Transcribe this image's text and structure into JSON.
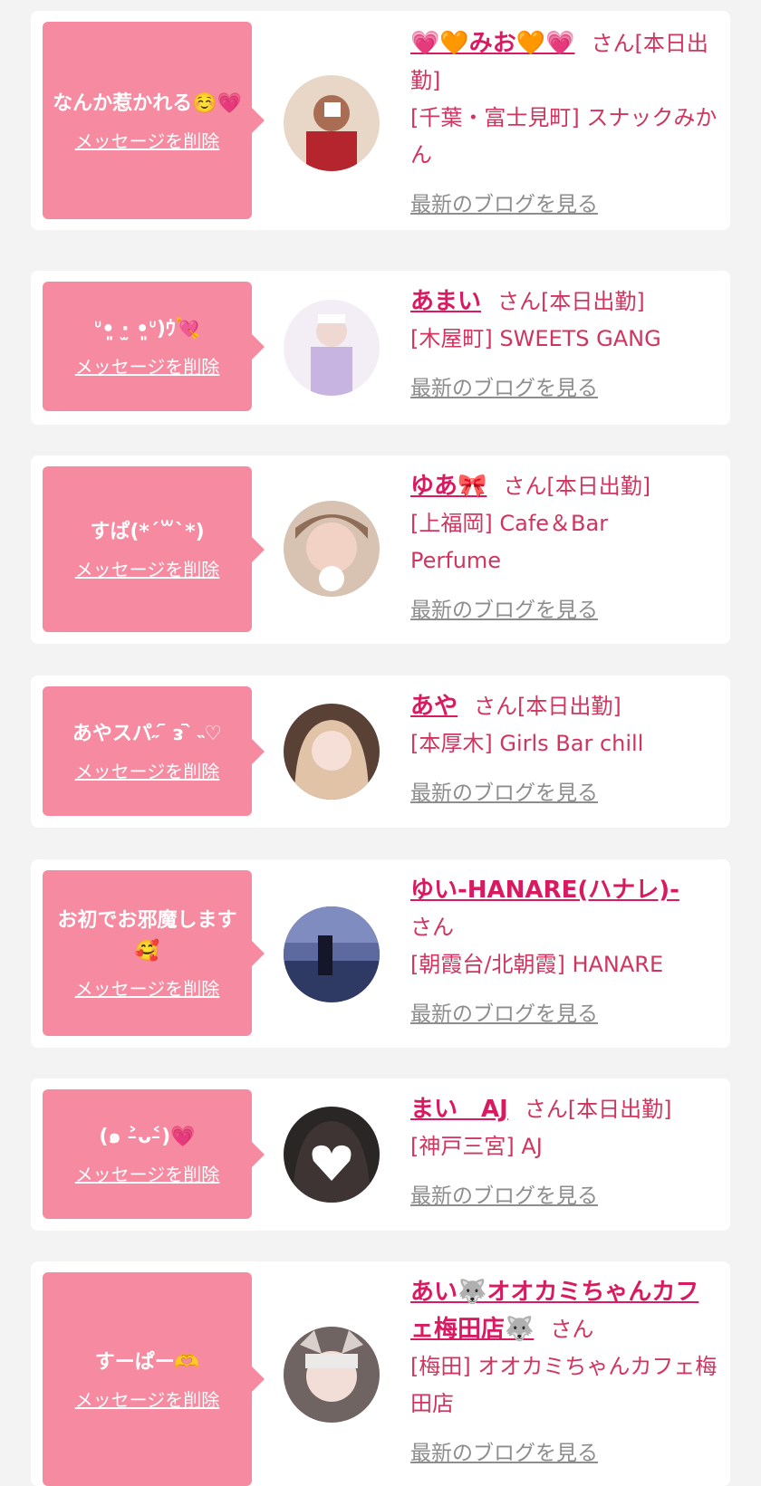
{
  "messages": [
    {
      "text": "なんか惹かれる☺️💗",
      "delete_label": "メッセージを削除",
      "cast_name": "💗🧡みお🧡💗",
      "suffix": "さん[本日出勤]",
      "shop": "[千葉・富士見町] スナックみかん",
      "blog_label": "最新のブログを見る",
      "avatar_color": "#c98b6f"
    },
    {
      "text": "ᐡ•͈ ·̫ •͈ᐡ)ｳ💘",
      "delete_label": "メッセージを削除",
      "cast_name": "あまい",
      "suffix": "さん[本日出勤]",
      "shop": "[木屋町] SWEETS GANG",
      "blog_label": "最新のブログを見る",
      "avatar_color": "#e7dce9"
    },
    {
      "text": "すぱ(*´꒳`*)",
      "delete_label": "メッセージを削除",
      "cast_name": "ゆあ🎀",
      "suffix": "さん[本日出勤]",
      "shop": "[上福岡] Cafe＆Bar Perfume",
      "blog_label": "最新のブログを見る",
      "avatar_color": "#b99a88"
    },
    {
      "text": "あやスパ˶ ᷇ ᴈ ᷆ ˵♡",
      "delete_label": "メッセージを削除",
      "cast_name": "あや",
      "suffix": "さん[本日出勤]",
      "shop": "[本厚木] Girls Bar chill",
      "blog_label": "最新のブログを見る",
      "avatar_color": "#cfa791"
    },
    {
      "text": "お初でお邪魔します🥰",
      "delete_label": "メッセージを削除",
      "cast_name": "ゆい-HANARE(ハナレ)-",
      "suffix": "さん",
      "shop": "[朝霞台/北朝霞] HANARE",
      "blog_label": "最新のブログを見る",
      "avatar_color": "#3a4772"
    },
    {
      "text": "(๑ ˃̵ᴗ˂̵)💗",
      "delete_label": "メッセージを削除",
      "cast_name": "まい　AJ",
      "suffix": "さん[本日出勤]",
      "shop": "[神戸三宮] AJ",
      "blog_label": "最新のブログを見る",
      "avatar_color": "#2f2a2a"
    },
    {
      "text": "すーぱー🫶",
      "delete_label": "メッセージを削除",
      "cast_name": "あい🐺オオカミちゃんカフェ梅田店🐺",
      "suffix": "さん",
      "shop": "[梅田] オオカミちゃんカフェ梅田店",
      "blog_label": "最新のブログを見る",
      "avatar_color": "#8c7f7a"
    }
  ]
}
